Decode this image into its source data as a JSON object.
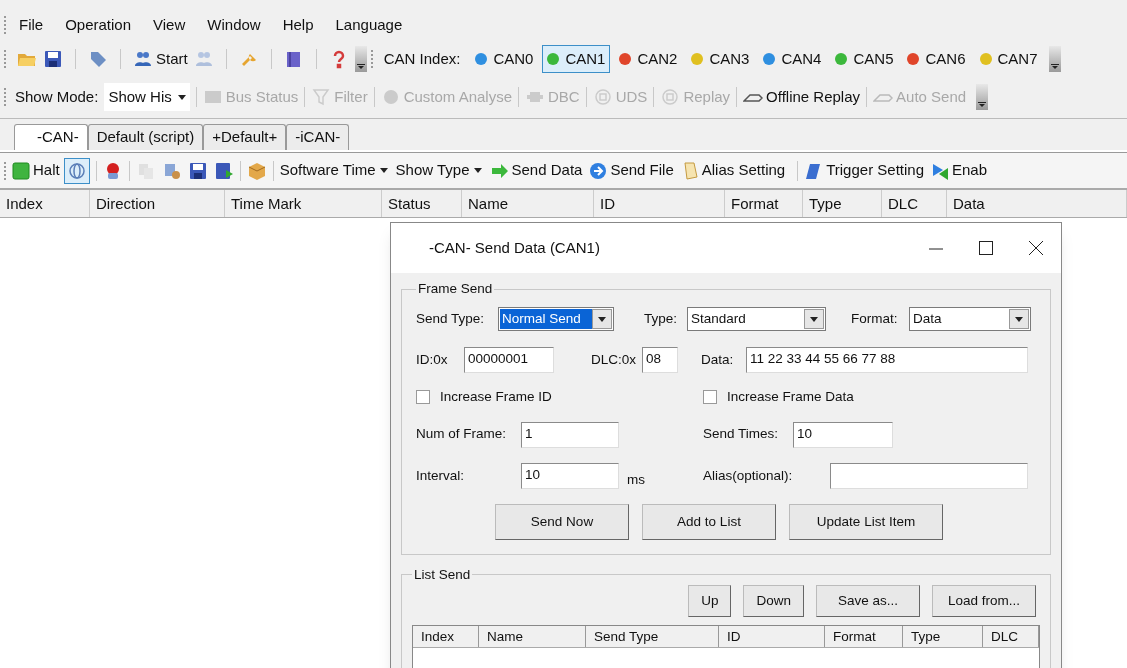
{
  "menu": [
    "File",
    "Operation",
    "View",
    "Window",
    "Help",
    "Language"
  ],
  "toolbar1": {
    "start": "Start",
    "can_index_label": "CAN Index:",
    "channels": [
      {
        "label": "CAN0",
        "color": "#2f8fe0",
        "selected": false
      },
      {
        "label": "CAN1",
        "color": "#3cb83c",
        "selected": true
      },
      {
        "label": "CAN2",
        "color": "#e0452a",
        "selected": false
      },
      {
        "label": "CAN3",
        "color": "#e0c020",
        "selected": false
      },
      {
        "label": "CAN4",
        "color": "#2f8fe0",
        "selected": false
      },
      {
        "label": "CAN5",
        "color": "#3cb83c",
        "selected": false
      },
      {
        "label": "CAN6",
        "color": "#e0452a",
        "selected": false
      },
      {
        "label": "CAN7",
        "color": "#e0c020",
        "selected": false
      }
    ]
  },
  "toolbar2": {
    "show_mode_label": "Show Mode:",
    "show_mode_value": "Show His",
    "items": [
      {
        "label": "Bus Status",
        "disabled": true
      },
      {
        "label": "Filter",
        "disabled": true
      },
      {
        "label": "Custom Analyse",
        "disabled": true
      },
      {
        "label": "DBC",
        "disabled": true
      },
      {
        "label": "UDS",
        "disabled": true
      },
      {
        "label": "Replay",
        "disabled": true
      },
      {
        "label": "Offline Replay",
        "disabled": false
      },
      {
        "label": "Auto Send",
        "disabled": true
      }
    ]
  },
  "tabs": [
    {
      "label": "-CAN-",
      "selected": true
    },
    {
      "label": "Default (script)",
      "selected": false
    },
    {
      "label": "+Default+",
      "selected": false
    },
    {
      "label": "-iCAN-",
      "selected": false
    }
  ],
  "toolbar3": {
    "halt": "Halt",
    "dropdowns": [
      "Software Time",
      "Show Type"
    ],
    "actions": [
      "Send Data",
      "Send File",
      "Alias Setting",
      "Trigger Setting",
      "Enab"
    ]
  },
  "table": {
    "columns": [
      "Index",
      "Direction",
      "Time Mark",
      "Status",
      "Name",
      "ID",
      "Format",
      "Type",
      "DLC",
      "Data"
    ]
  },
  "dialog": {
    "title": "-CAN- Send Data (CAN1)",
    "frame_send": {
      "legend": "Frame Send",
      "send_type": {
        "label": "Send Type:",
        "value": "Normal Send"
      },
      "type": {
        "label": "Type:",
        "value": "Standard"
      },
      "format": {
        "label": "Format:",
        "value": "Data"
      },
      "id": {
        "label": "ID:0x",
        "value": "00000001"
      },
      "dlc": {
        "label": "DLC:0x",
        "value": "08"
      },
      "data": {
        "label": "Data:",
        "value": "11 22 33 44 55 66 77 88"
      },
      "increase_frame_id": {
        "label": "Increase Frame ID",
        "checked": false
      },
      "increase_frame_data": {
        "label": "Increase Frame Data",
        "checked": false
      },
      "num_of_frame": {
        "label": "Num of Frame:",
        "value": "1"
      },
      "send_times": {
        "label": "Send Times:",
        "value": "10"
      },
      "interval": {
        "label": "Interval:",
        "value": "10",
        "unit": "ms"
      },
      "alias": {
        "label": "Alias(optional):"
      },
      "buttons": [
        "Send Now",
        "Add to List",
        "Update List Item"
      ]
    },
    "list_send": {
      "legend": "List Send",
      "buttons": [
        "Up",
        "Down",
        "Save as...",
        "Load from..."
      ],
      "columns": [
        "Index",
        "Name",
        "Send Type",
        "ID",
        "Format",
        "Type",
        "DLC"
      ]
    }
  }
}
